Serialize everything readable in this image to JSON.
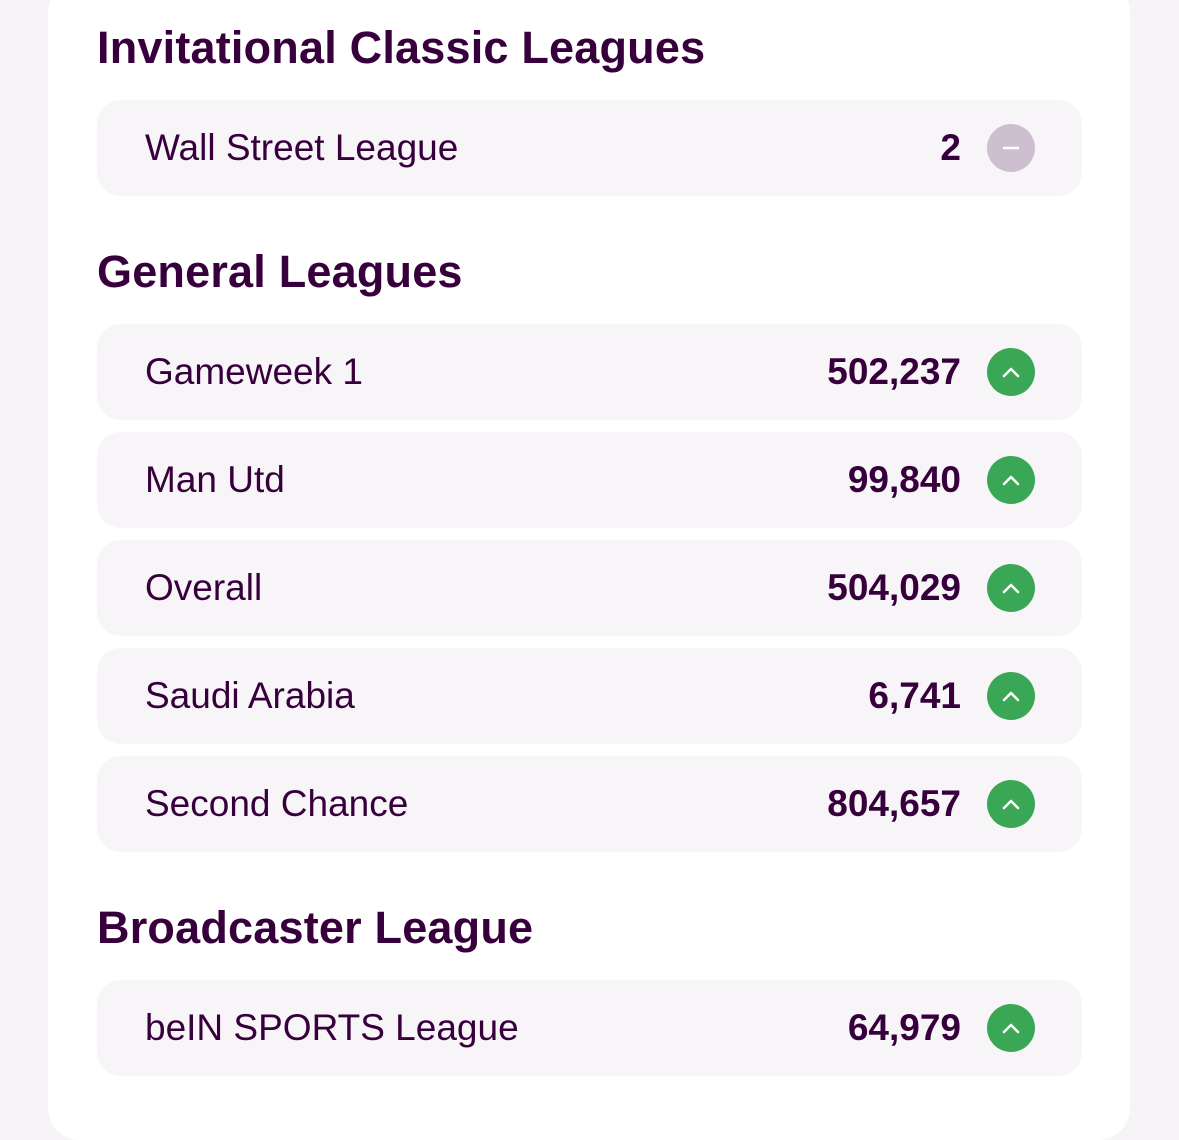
{
  "invitational": {
    "title": "Invitational Classic Leagues",
    "leagues": [
      {
        "name": "Wall Street League",
        "rank": "2",
        "movement": "same",
        "movement_icon": "minus-icon"
      }
    ]
  },
  "general": {
    "title": "General Leagues",
    "leagues": [
      {
        "name": "Gameweek 1",
        "rank": "502,237",
        "movement": "up",
        "movement_icon": "chevron-up-icon"
      },
      {
        "name": "Man Utd",
        "rank": "99,840",
        "movement": "up",
        "movement_icon": "chevron-up-icon"
      },
      {
        "name": "Overall",
        "rank": "504,029",
        "movement": "up",
        "movement_icon": "chevron-up-icon"
      },
      {
        "name": "Saudi Arabia",
        "rank": "6,741",
        "movement": "up",
        "movement_icon": "chevron-up-icon"
      },
      {
        "name": "Second Chance",
        "rank": "804,657",
        "movement": "up",
        "movement_icon": "chevron-up-icon"
      }
    ]
  },
  "broadcaster": {
    "title": "Broadcaster League",
    "leagues": [
      {
        "name": "beIN SPORTS League",
        "rank": "64,979",
        "movement": "up",
        "movement_icon": "chevron-up-icon"
      }
    ]
  },
  "colors": {
    "text": "#37003c",
    "up": "#3aa757",
    "same": "#cdbfcf",
    "row_bg": "#f8f5f8",
    "page_bg": "#f6f4f7",
    "card_bg": "#ffffff"
  }
}
